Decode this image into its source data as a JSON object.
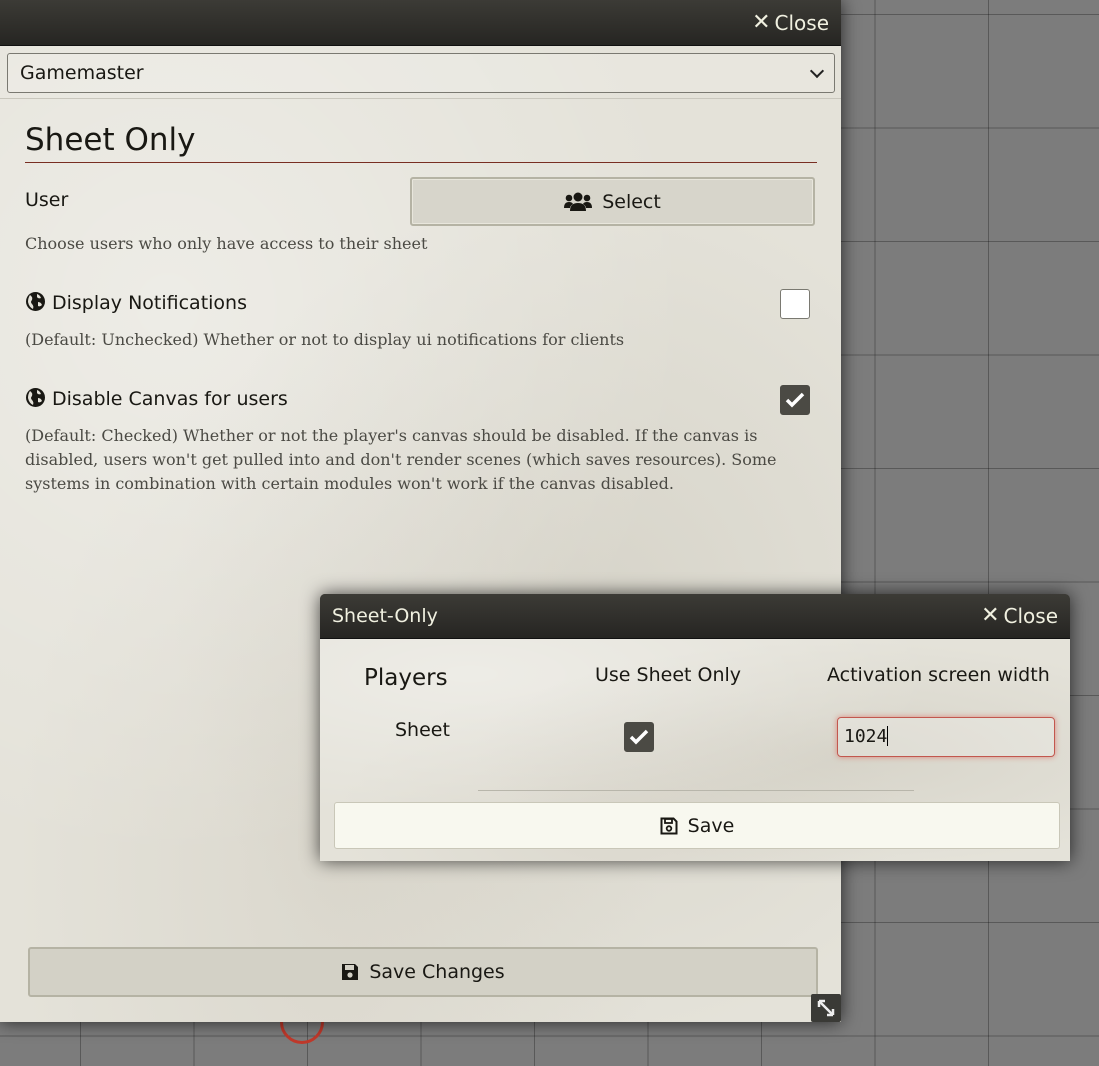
{
  "main_window": {
    "close_label": "Close",
    "role_select": {
      "selected": "Gamemaster"
    },
    "section_title": "Sheet Only",
    "user_setting": {
      "label": "User",
      "button_label": "Select",
      "hint": "Choose users who only have access to their sheet"
    },
    "display_notifications": {
      "label": "Display Notifications",
      "hint": "(Default: Unchecked) Whether or not to display ui notifications for clients",
      "checked": false
    },
    "disable_canvas": {
      "label": "Disable Canvas for users",
      "hint": "(Default: Checked) Whether or not the player's canvas should be disabled. If the canvas is disabled, users won't get pulled into and don't render scenes (which saves resources). Some systems in combination with certain modules won't work if the canvas disabled.",
      "checked": true
    },
    "save_changes_label": "Save Changes"
  },
  "sheet_only_dialog": {
    "title": "Sheet-Only",
    "close_label": "Close",
    "columns": {
      "players": "Players",
      "use_sheet_only": "Use Sheet Only",
      "activation_width": "Activation screen width"
    },
    "rows": [
      {
        "player": "Sheet",
        "use_sheet_only": true,
        "activation_width": "1024"
      }
    ],
    "save_label": "Save"
  },
  "colors": {
    "header_bg": "#2f2f2b",
    "parchment": "#e4e2d9",
    "accent_rule": "#782e22",
    "input_focus": "#c2574e"
  }
}
